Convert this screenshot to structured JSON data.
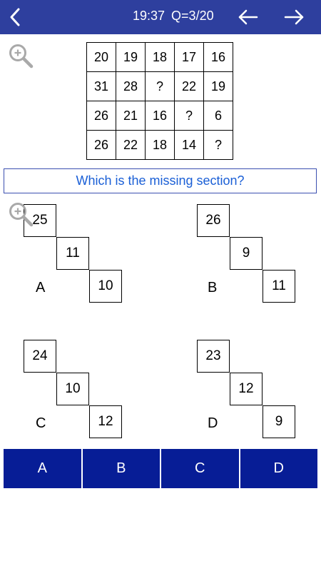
{
  "header": {
    "time": "19:37",
    "question_counter": "Q=3/20"
  },
  "puzzle": {
    "rows": [
      [
        "20",
        "19",
        "18",
        "17",
        "16"
      ],
      [
        "31",
        "28",
        "?",
        "22",
        "19"
      ],
      [
        "26",
        "21",
        "16",
        "?",
        "6"
      ],
      [
        "26",
        "22",
        "18",
        "14",
        "?"
      ]
    ]
  },
  "question_text": "Which is the missing section?",
  "options": [
    {
      "letter": "A",
      "values": [
        "25",
        "11",
        "10"
      ]
    },
    {
      "letter": "B",
      "values": [
        "26",
        "9",
        "11"
      ]
    },
    {
      "letter": "C",
      "values": [
        "24",
        "10",
        "12"
      ]
    },
    {
      "letter": "D",
      "values": [
        "23",
        "12",
        "9"
      ]
    }
  ],
  "answer_buttons": [
    "A",
    "B",
    "C",
    "D"
  ],
  "colors": {
    "header_bg": "#2e3f9e",
    "answer_bg": "#071d96",
    "question_text": "#1a5fd6"
  },
  "icons": {
    "back": "chevron-left-icon",
    "prev": "arrow-left-icon",
    "next": "arrow-right-icon",
    "zoom": "zoom-in-icon"
  }
}
